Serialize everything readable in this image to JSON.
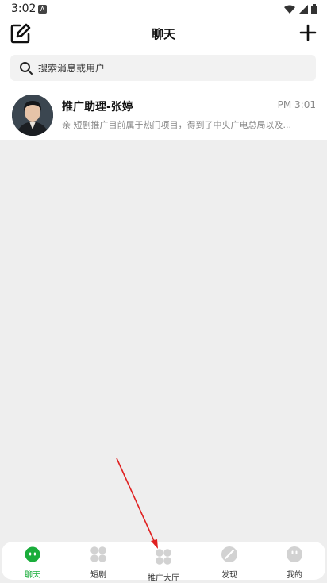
{
  "status": {
    "time": "3:02",
    "notif_letter": "A"
  },
  "header": {
    "title": "聊天"
  },
  "search": {
    "placeholder": "搜索消息或用户"
  },
  "chats": [
    {
      "name": "推广助理-张婷",
      "time": "PM 3:01",
      "preview": "亲 短剧推广目前属于热门项目，得到了中央广电总局以及..."
    }
  ],
  "tabs": [
    {
      "label": "聊天",
      "icon": "chat-icon",
      "active": true
    },
    {
      "label": "短剧",
      "icon": "grid-icon",
      "active": false
    },
    {
      "label": "推广大厅",
      "icon": "grid-icon",
      "active": false
    },
    {
      "label": "发现",
      "icon": "compass-icon",
      "active": false
    },
    {
      "label": "我的",
      "icon": "profile-icon",
      "active": false
    }
  ],
  "colors": {
    "accent": "#1aad3b",
    "annotation": "#e02020"
  }
}
